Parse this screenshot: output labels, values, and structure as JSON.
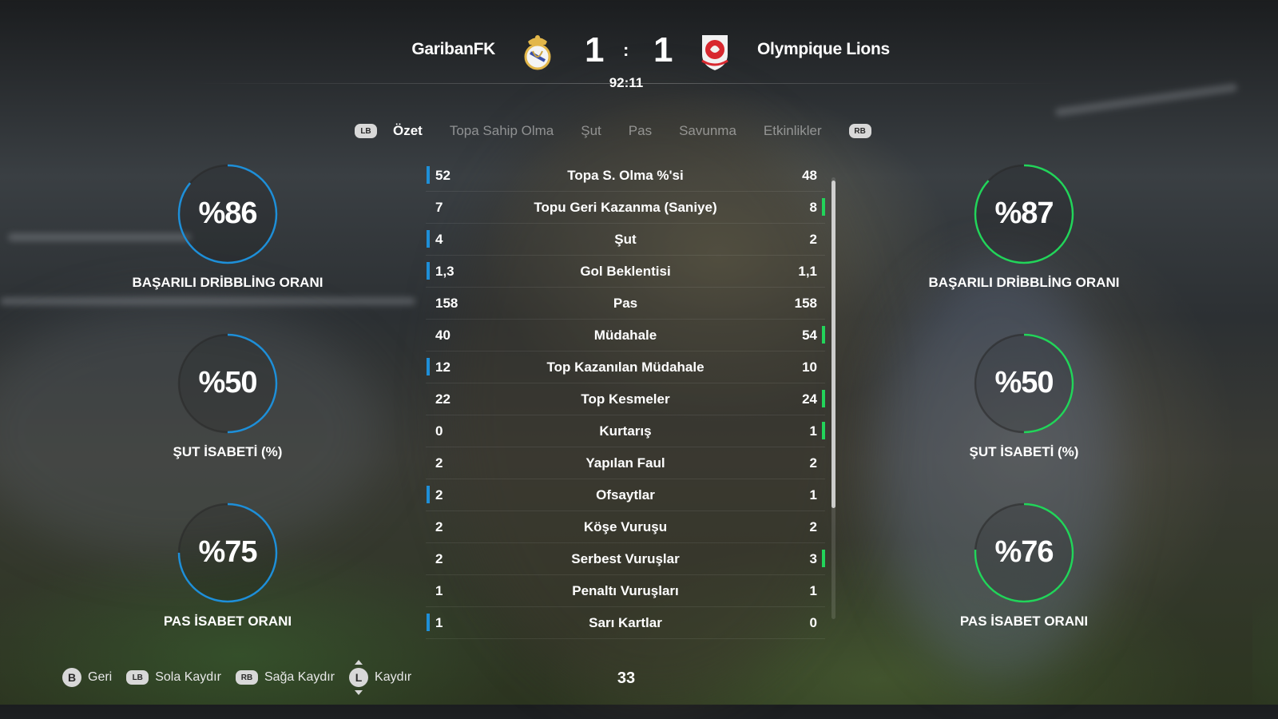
{
  "match": {
    "home_team": "GaribanFK",
    "away_team": "Olympique Lions",
    "home_score": "1",
    "away_score": "1",
    "separator": ":",
    "clock": "92:11"
  },
  "tabs": {
    "lb": "LB",
    "rb": "RB",
    "items": [
      "Özet",
      "Topa Sahip Olma",
      "Şut",
      "Pas",
      "Savunma",
      "Etkinlikler"
    ],
    "active": "Özet"
  },
  "colors": {
    "home": "#1e8fd8",
    "away": "#22d45a"
  },
  "home_gauges": [
    {
      "value": "%86",
      "pct": 86,
      "label": "BAŞARILI DRİBBLİNG ORANI"
    },
    {
      "value": "%50",
      "pct": 50,
      "label": "ŞUT İSABETİ (%)"
    },
    {
      "value": "%75",
      "pct": 75,
      "label": "PAS İSABET ORANI"
    }
  ],
  "away_gauges": [
    {
      "value": "%87",
      "pct": 87,
      "label": "BAŞARILI DRİBBLİNG ORANI"
    },
    {
      "value": "%50",
      "pct": 50,
      "label": "ŞUT İSABETİ (%)"
    },
    {
      "value": "%76",
      "pct": 76,
      "label": "PAS İSABET ORANI"
    }
  ],
  "stats": [
    {
      "name": "Topa S. Olma %'si",
      "home": "52",
      "away": "48",
      "lead": "home"
    },
    {
      "name": "Topu Geri Kazanma (Saniye)",
      "home": "7",
      "away": "8",
      "lead": "away"
    },
    {
      "name": "Şut",
      "home": "4",
      "away": "2",
      "lead": "home"
    },
    {
      "name": "Gol Beklentisi",
      "home": "1,3",
      "away": "1,1",
      "lead": "home"
    },
    {
      "name": "Pas",
      "home": "158",
      "away": "158",
      "lead": "none"
    },
    {
      "name": "Müdahale",
      "home": "40",
      "away": "54",
      "lead": "away"
    },
    {
      "name": "Top Kazanılan Müdahale",
      "home": "12",
      "away": "10",
      "lead": "home"
    },
    {
      "name": "Top Kesmeler",
      "home": "22",
      "away": "24",
      "lead": "away"
    },
    {
      "name": "Kurtarış",
      "home": "0",
      "away": "1",
      "lead": "away"
    },
    {
      "name": "Yapılan Faul",
      "home": "2",
      "away": "2",
      "lead": "none"
    },
    {
      "name": "Ofsaytlar",
      "home": "2",
      "away": "1",
      "lead": "home"
    },
    {
      "name": "Köşe Vuruşu",
      "home": "2",
      "away": "2",
      "lead": "none"
    },
    {
      "name": "Serbest Vuruşlar",
      "home": "2",
      "away": "3",
      "lead": "away"
    },
    {
      "name": "Penaltı Vuruşları",
      "home": "1",
      "away": "1",
      "lead": "none"
    },
    {
      "name": "Sarı Kartlar",
      "home": "1",
      "away": "0",
      "lead": "home"
    }
  ],
  "footer": {
    "back_key": "B",
    "back_label": "Geri",
    "left_key": "LB",
    "left_label": "Sola Kaydır",
    "right_key": "RB",
    "right_label": "Sağa Kaydır",
    "scroll_key": "L",
    "scroll_label": "Kaydır",
    "page_number": "33"
  }
}
